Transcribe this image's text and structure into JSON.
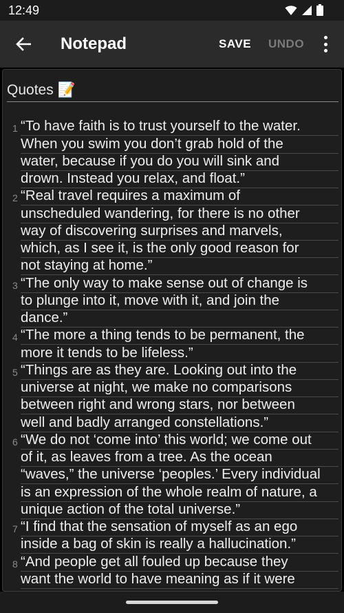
{
  "status_bar": {
    "time": "12:49"
  },
  "app_bar": {
    "title": "Notepad",
    "save_label": "SAVE",
    "undo_label": "UNDO"
  },
  "note": {
    "title": "Quotes 📝",
    "lines": [
      {
        "num": "1",
        "text": "“To have faith is to trust yourself to the water."
      },
      {
        "num": "",
        "text": "When you swim you don’t grab hold of the"
      },
      {
        "num": "",
        "text": "water, because if you do you will sink and"
      },
      {
        "num": "",
        "text": "drown. Instead you relax, and float.”"
      },
      {
        "num": "2",
        "text": "“Real travel requires a maximum of"
      },
      {
        "num": "",
        "text": "unscheduled wandering, for there is no other"
      },
      {
        "num": "",
        "text": "way of discovering surprises and marvels,"
      },
      {
        "num": "",
        "text": "which, as I see it, is the only good reason for"
      },
      {
        "num": "",
        "text": "not staying at home.”"
      },
      {
        "num": "3",
        "text": "“The only way to make sense out of change is"
      },
      {
        "num": "",
        "text": "to plunge into it, move with it, and join the"
      },
      {
        "num": "",
        "text": "dance.”"
      },
      {
        "num": "4",
        "text": "“The more a thing tends to be permanent, the"
      },
      {
        "num": "",
        "text": "more it tends to be lifeless.”"
      },
      {
        "num": "5",
        "text": "“Things are as they are. Looking out into the"
      },
      {
        "num": "",
        "text": "universe at night, we make no comparisons"
      },
      {
        "num": "",
        "text": "between right and wrong stars, nor between"
      },
      {
        "num": "",
        "text": "well and badly arranged constellations.”"
      },
      {
        "num": "6",
        "text": "“We do not ‘come into’ this world; we come out"
      },
      {
        "num": "",
        "text": "of it, as leaves from a tree. As the ocean"
      },
      {
        "num": "",
        "text": "“waves,” the universe ‘peoples.’ Every individual"
      },
      {
        "num": "",
        "text": "is an expression of the whole realm of nature, a"
      },
      {
        "num": "",
        "text": "unique action of the total universe.”"
      },
      {
        "num": "7",
        "text": "“I find that the sensation of myself as an ego"
      },
      {
        "num": "",
        "text": "inside a bag of skin is really a hallucination.”"
      },
      {
        "num": "8",
        "text": "“And people get all fouled up because they"
      },
      {
        "num": "",
        "text": "want the world to have meaning as if it were"
      }
    ]
  },
  "colors": {
    "background": "#1e1e1e",
    "app_bar": "#2b2b2b",
    "text": "#ededed",
    "disabled": "#7b7b7b"
  },
  "icons": [
    "wifi-icon",
    "signal-icon",
    "battery-icon",
    "back-arrow-icon",
    "more-vert-icon"
  ]
}
